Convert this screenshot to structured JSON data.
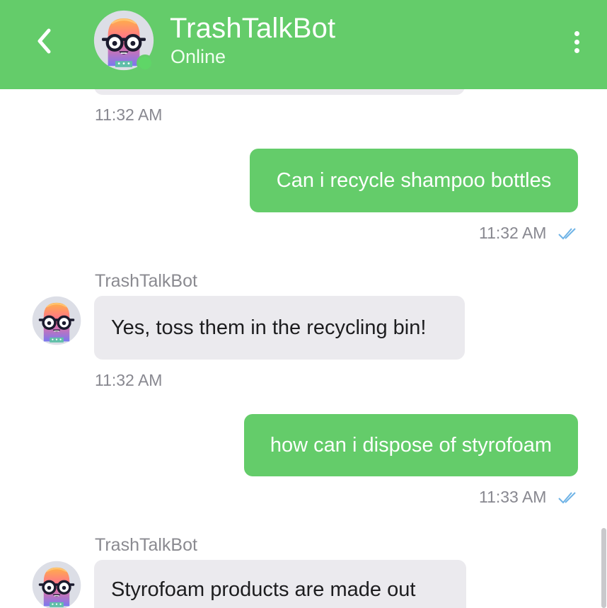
{
  "header": {
    "back_icon": "chevron-left-icon",
    "title": "TrashTalkBot",
    "status": "Online",
    "menu_icon": "more-vertical-icon",
    "color": "#64cc6a"
  },
  "messages": [
    {
      "direction": "in",
      "time": "11:32 AM"
    },
    {
      "direction": "out",
      "text": "Can i recycle shampoo bottles",
      "time": "11:32 AM",
      "read_icon": "double-check-icon"
    },
    {
      "direction": "in",
      "sender": "TrashTalkBot",
      "text": "Yes, toss them in the recycling bin!",
      "time": "11:32 AM"
    },
    {
      "direction": "out",
      "text": "how can i dispose of styrofoam",
      "time": "11:33 AM",
      "read_icon": "double-check-icon"
    },
    {
      "direction": "in",
      "sender": "TrashTalkBot",
      "text": "Styrofoam products are made out"
    }
  ],
  "colors": {
    "out_bubble": "#64cc6a",
    "in_bubble": "#ebeaee",
    "read_check": "#6fb3e6"
  }
}
